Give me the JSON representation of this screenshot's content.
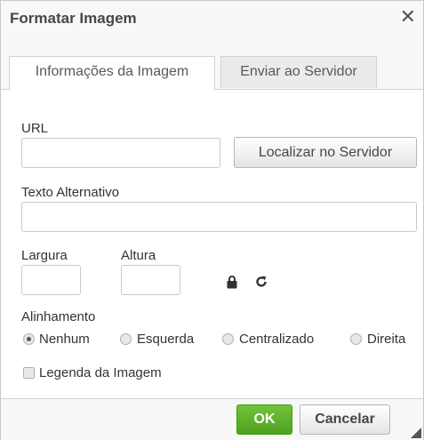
{
  "dialog": {
    "title": "Formatar Imagem",
    "close_glyph": "✕"
  },
  "tabs": [
    {
      "label": "Informações da Imagem",
      "active": true
    },
    {
      "label": "Enviar ao Servidor",
      "active": false
    }
  ],
  "form": {
    "url_label": "URL",
    "url_value": "",
    "browse_button": "Localizar no Servidor",
    "alt_label": "Texto Alternativo",
    "alt_value": "",
    "width_label": "Largura",
    "width_value": "",
    "height_label": "Altura",
    "height_value": "",
    "lock_icon": "lock-icon",
    "reset_icon": "reset-size-icon",
    "align_label": "Alinhamento",
    "align_options": [
      "Nenhum",
      "Esquerda",
      "Centralizado",
      "Direita"
    ],
    "align_selected": "Nenhum",
    "caption_label": "Legenda da Imagem",
    "caption_checked": false
  },
  "footer": {
    "ok_label": "OK",
    "cancel_label": "Cancelar"
  },
  "colors": {
    "ok_button": "#5cb42a",
    "chrome_background": "#f8f8f8"
  }
}
